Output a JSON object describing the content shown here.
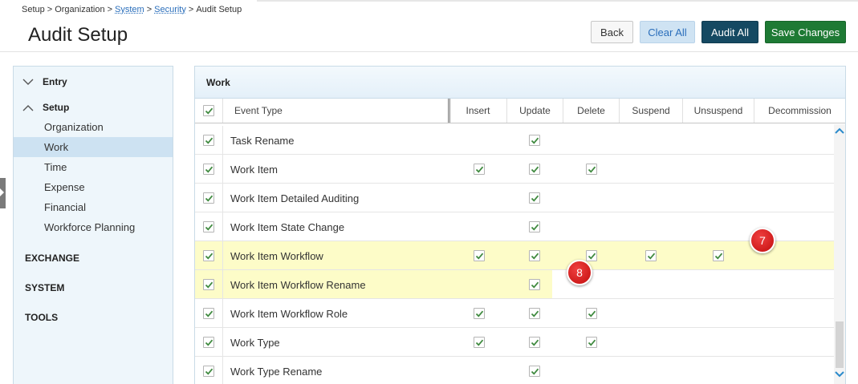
{
  "breadcrumb": {
    "items": [
      "Setup",
      "Organization",
      "System",
      "Security",
      "Audit Setup"
    ],
    "separator": ">"
  },
  "page": {
    "title": "Audit Setup"
  },
  "toolbar": {
    "back_label": "Back",
    "clear_all_label": "Clear All",
    "audit_all_label": "Audit All",
    "save_label": "Save Changes"
  },
  "sidebar": {
    "entry_label": "Entry",
    "setup_label": "Setup",
    "setup_items": [
      "Organization",
      "Work",
      "Time",
      "Expense",
      "Financial",
      "Workforce Planning"
    ],
    "active_item": "Work",
    "categories": [
      "EXCHANGE",
      "SYSTEM",
      "TOOLS"
    ]
  },
  "panel": {
    "title": "Work",
    "columns": [
      "Event Type",
      "Insert",
      "Update",
      "Delete",
      "Suspend",
      "Unsuspend",
      "Decommission"
    ],
    "rows": [
      {
        "label": "Task Rename",
        "checks": [
          false,
          true,
          false,
          false,
          false,
          false
        ]
      },
      {
        "label": "Work Item",
        "checks": [
          true,
          true,
          true,
          false,
          false,
          false
        ]
      },
      {
        "label": "Work Item Detailed Auditing",
        "checks": [
          false,
          true,
          false,
          false,
          false,
          false
        ]
      },
      {
        "label": "Work Item State Change",
        "checks": [
          false,
          true,
          false,
          false,
          false,
          false
        ]
      },
      {
        "label": "Work Item Workflow",
        "checks": [
          true,
          true,
          true,
          true,
          true,
          false
        ]
      },
      {
        "label": "Work Item Workflow Rename",
        "checks": [
          false,
          true,
          false,
          false,
          false,
          false
        ]
      },
      {
        "label": "Work Item Workflow Role",
        "checks": [
          true,
          true,
          true,
          false,
          false,
          false
        ]
      },
      {
        "label": "Work Type",
        "checks": [
          true,
          true,
          true,
          false,
          false,
          false
        ]
      },
      {
        "label": "Work Type Rename",
        "checks": [
          false,
          true,
          false,
          false,
          false,
          false
        ]
      }
    ]
  },
  "callouts": [
    "7",
    "8"
  ],
  "colors": {
    "accent": "#2a6ebb",
    "audit_all_bg": "#154962",
    "save_bg": "#1e7a34",
    "highlight": "#fdfcc8",
    "check": "#3f8a3f",
    "callout": "#d91a1a"
  }
}
